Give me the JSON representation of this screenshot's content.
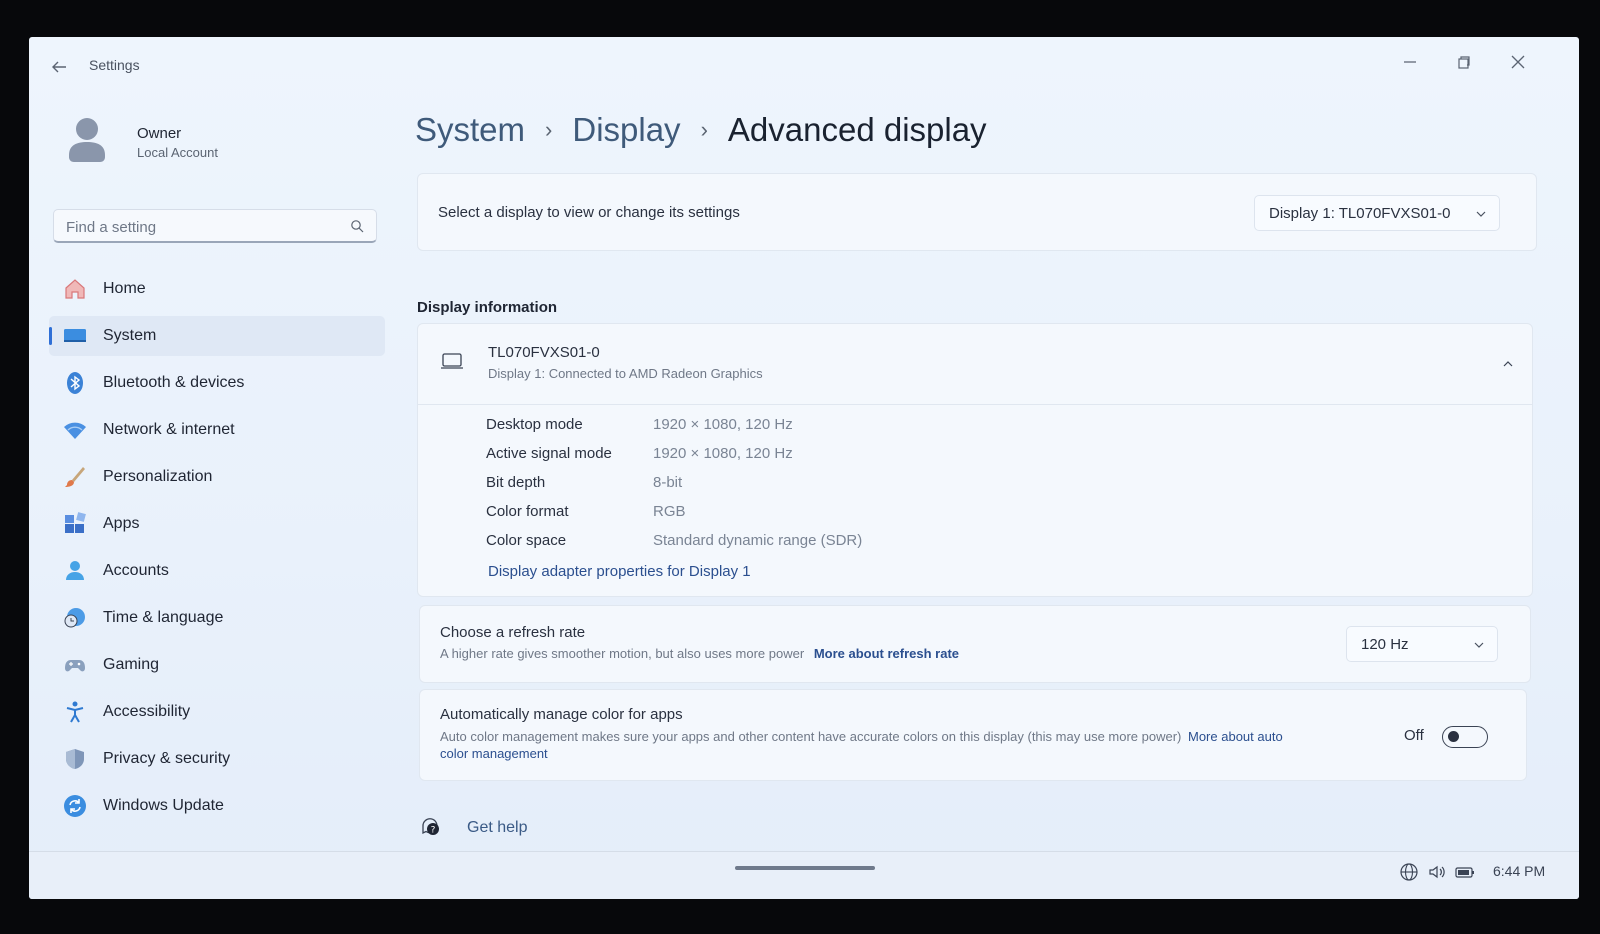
{
  "window": {
    "app_title": "Settings"
  },
  "profile": {
    "name": "Owner",
    "account_type": "Local Account"
  },
  "search": {
    "placeholder": "Find a setting"
  },
  "nav": {
    "items": [
      {
        "label": "Home",
        "icon": "home-icon"
      },
      {
        "label": "System",
        "icon": "system-icon",
        "selected": true
      },
      {
        "label": "Bluetooth & devices",
        "icon": "bluetooth-icon"
      },
      {
        "label": "Network & internet",
        "icon": "wifi-icon"
      },
      {
        "label": "Personalization",
        "icon": "brush-icon"
      },
      {
        "label": "Apps",
        "icon": "apps-icon"
      },
      {
        "label": "Accounts",
        "icon": "person-icon"
      },
      {
        "label": "Time & language",
        "icon": "globe-clock-icon"
      },
      {
        "label": "Gaming",
        "icon": "gamepad-icon"
      },
      {
        "label": "Accessibility",
        "icon": "accessibility-icon"
      },
      {
        "label": "Privacy & security",
        "icon": "shield-icon"
      },
      {
        "label": "Windows Update",
        "icon": "update-icon"
      }
    ]
  },
  "breadcrumb": {
    "level1": "System",
    "level2": "Display",
    "current": "Advanced display"
  },
  "display_select": {
    "label": "Select a display to view or change its settings",
    "selected": "Display 1: TL070FVXS01-0"
  },
  "display_info": {
    "section_title": "Display information",
    "device_name": "TL070FVXS01-0",
    "device_sub": "Display 1: Connected to AMD Radeon Graphics",
    "rows": [
      {
        "label": "Desktop mode",
        "value": "1920 × 1080, 120 Hz"
      },
      {
        "label": "Active signal mode",
        "value": "1920 × 1080, 120 Hz"
      },
      {
        "label": "Bit depth",
        "value": "8-bit"
      },
      {
        "label": "Color format",
        "value": "RGB"
      },
      {
        "label": "Color space",
        "value": "Standard dynamic range (SDR)"
      }
    ],
    "adapter_link": "Display adapter properties for Display 1"
  },
  "refresh_rate": {
    "title": "Choose a refresh rate",
    "description": "A higher rate gives smoother motion, but also uses more power",
    "link": "More about refresh rate",
    "selected": "120 Hz"
  },
  "auto_color": {
    "title": "Automatically manage color for apps",
    "description_line1": "Auto color management makes sure your apps and other content have accurate colors on this display (this may use more power)",
    "link_line1": "More about auto",
    "link_line2": "color management",
    "state_label": "Off",
    "enabled": false
  },
  "help": {
    "label": "Get help"
  },
  "taskbar": {
    "time": "6:44 PM"
  }
}
